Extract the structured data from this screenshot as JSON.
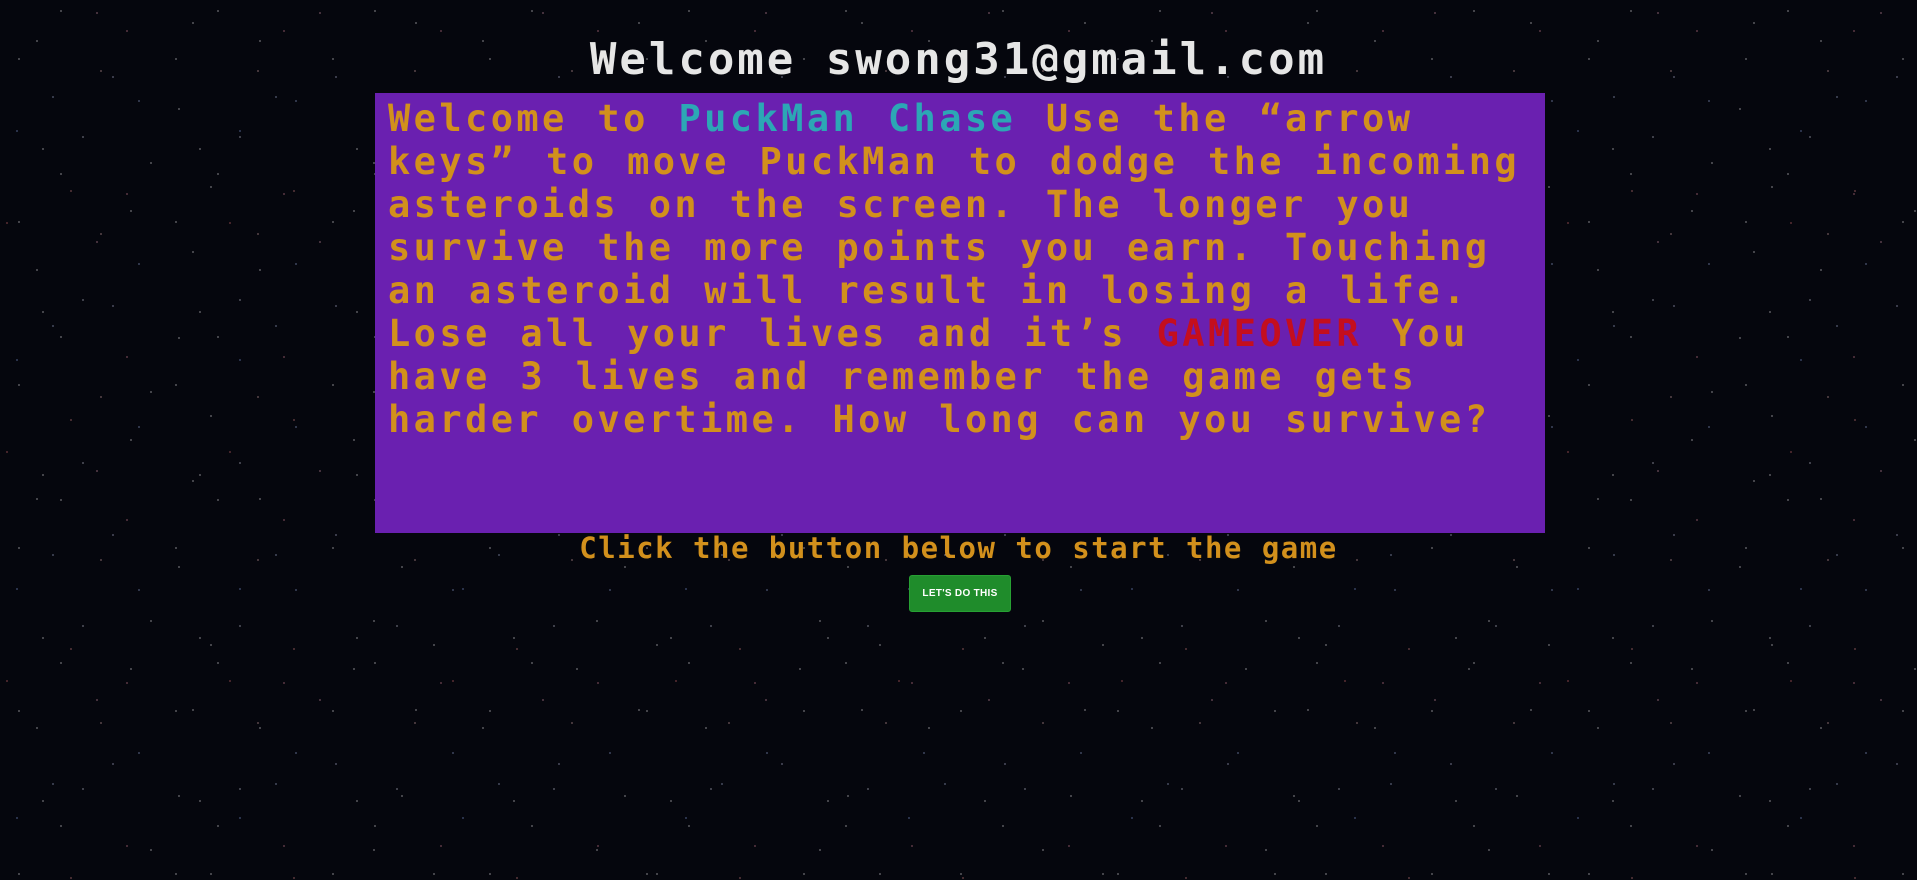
{
  "header": {
    "welcome_text": "Welcome swong31@gmail.com"
  },
  "instructions": {
    "part1": "Welcome to ",
    "game_name": "PuckMan Chase",
    "part2": " Use the “arrow keys” to move PuckMan to dodge the incoming asteroids on the screen. The longer you survive the more points you earn. Touching an asteroid will result in losing a life. Lose all your lives and it’s ",
    "gameover": "GAMEOVER",
    "part3": " You have 3 lives and remember the game gets harder overtime. How long can you survive?"
  },
  "start": {
    "prompt": "Click the button below to start the game",
    "button_label": "LET'S DO THIS"
  },
  "colors": {
    "background": "#05060d",
    "panel": "#6a20b0",
    "text_orange": "#d2901c",
    "game_name": "#2ca7b5",
    "gameover": "#c40e1e",
    "button": "#1f8c2b",
    "title": "#e6e6e6"
  }
}
